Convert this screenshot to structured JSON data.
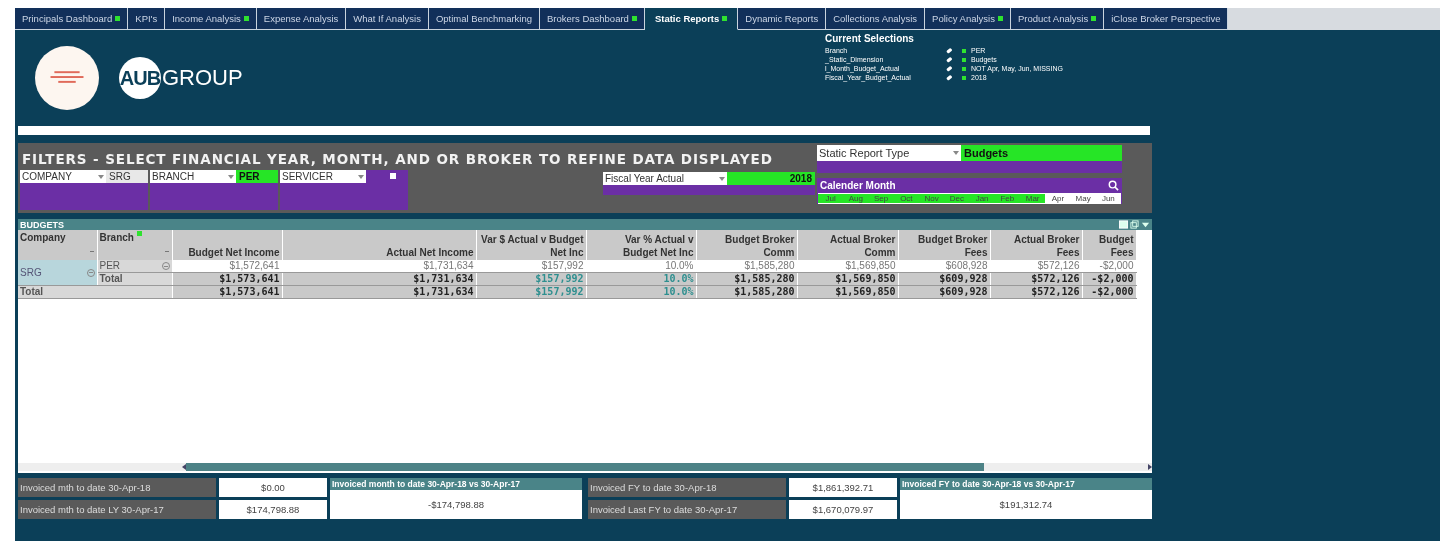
{
  "tabs": [
    {
      "label": "Principals Dashboard",
      "flagged": true,
      "selected": false
    },
    {
      "label": "KPI's",
      "flagged": false,
      "selected": false
    },
    {
      "label": "Income Analysis",
      "flagged": true,
      "selected": false
    },
    {
      "label": "Expense Analysis",
      "flagged": false,
      "selected": false
    },
    {
      "label": "What If Analysis",
      "flagged": false,
      "selected": false
    },
    {
      "label": "Optimal Benchmarking",
      "flagged": false,
      "selected": false
    },
    {
      "label": "Brokers Dashboard",
      "flagged": true,
      "selected": false
    },
    {
      "label": "Static Reports",
      "flagged": true,
      "selected": true
    },
    {
      "label": "Dynamic Reports",
      "flagged": false,
      "selected": false
    },
    {
      "label": "Collections Analysis",
      "flagged": false,
      "selected": false
    },
    {
      "label": "Policy Analysis",
      "flagged": true,
      "selected": false
    },
    {
      "label": "Product Analysis",
      "flagged": true,
      "selected": false
    },
    {
      "label": "iClose Broker Perspective",
      "flagged": false,
      "selected": false
    }
  ],
  "logo": {
    "mark": "AUB",
    "word": "GROUP"
  },
  "current_selections": {
    "title": "Current Selections",
    "items": [
      {
        "field": "Branch",
        "value": "PER"
      },
      {
        "field": "_Static_Dimension",
        "value": "Budgets"
      },
      {
        "field": "l_Month_Budget_Actual",
        "value": "NOT Apr, May, Jun, MISSING"
      },
      {
        "field": "Fiscal_Year_Budget_Actual",
        "value": "2018"
      }
    ]
  },
  "filters": {
    "title": "FILTERS - SELECT FINANCIAL YEAR, MONTH, AND OR BROKER TO REFINE DATA DISPLAYED",
    "dropdowns": [
      {
        "label": "COMPANY",
        "value": "SRG",
        "selected": false
      },
      {
        "label": "BRANCH",
        "value": "PER",
        "selected": true
      },
      {
        "label": "SERVICER"
      }
    ],
    "fiscal_year": {
      "label": "Fiscal Year Actual",
      "value": "2018",
      "selected": true
    },
    "report_type": {
      "label": "Static Report Type",
      "value": "Budgets",
      "selected": true
    },
    "calendar": {
      "title": "Calender Month",
      "months": [
        {
          "label": "Jul",
          "selected": true
        },
        {
          "label": "Aug",
          "selected": true
        },
        {
          "label": "Sep",
          "selected": true
        },
        {
          "label": "Oct",
          "selected": true
        },
        {
          "label": "Nov",
          "selected": true
        },
        {
          "label": "Dec",
          "selected": true
        },
        {
          "label": "Jan",
          "selected": true
        },
        {
          "label": "Feb",
          "selected": true
        },
        {
          "label": "Mar",
          "selected": true
        },
        {
          "label": "Apr",
          "selected": false
        },
        {
          "label": "May",
          "selected": false
        },
        {
          "label": "Jun",
          "selected": false
        }
      ]
    }
  },
  "table": {
    "title": "BUDGETS",
    "columns": [
      {
        "label": "Company",
        "kind": "dimension",
        "flagged": false
      },
      {
        "label": "Branch",
        "kind": "dimension",
        "flagged": true
      },
      {
        "label": "Budget Net Income",
        "kind": "money"
      },
      {
        "label": "Actual Net Income",
        "kind": "money"
      },
      {
        "label": "Var $ Actual v Budget Net Inc",
        "kind": "variance"
      },
      {
        "label": "Var % Actual v Budget Net Inc",
        "kind": "variance"
      },
      {
        "label": "Budget Broker Comm",
        "kind": "money"
      },
      {
        "label": "Actual Broker Comm",
        "kind": "money"
      },
      {
        "label": "Budget Broker Fees",
        "kind": "money"
      },
      {
        "label": "Actual Broker Fees",
        "kind": "money"
      },
      {
        "label": "Budget Fees",
        "kind": "money"
      }
    ],
    "rows": [
      {
        "kind": "detail",
        "company": "SRG",
        "selected": true,
        "branch": "PER",
        "values": [
          "$1,572,641",
          "$1,731,634",
          "$157,992",
          "10.0%",
          "$1,585,280",
          "$1,569,850",
          "$608,928",
          "$572,126",
          "-$2,000"
        ]
      },
      {
        "kind": "subtotal",
        "branch": "Total",
        "values": [
          "$1,573,641",
          "$1,731,634",
          "$157,992",
          "10.0%",
          "$1,585,280",
          "$1,569,850",
          "$609,928",
          "$572,126",
          "-$2,000"
        ]
      },
      {
        "kind": "total",
        "label": "Total",
        "values": [
          "$1,573,641",
          "$1,731,634",
          "$157,992",
          "10.0%",
          "$1,585,280",
          "$1,569,850",
          "$609,928",
          "$572,126",
          "-$2,000"
        ]
      }
    ]
  },
  "summary": [
    {
      "rows": [
        {
          "label": "Invoiced mth to date 30-Apr-18",
          "value": "$0.00"
        },
        {
          "label": "Invoiced mth to date LY 30-Apr-17",
          "value": "$174,798.88"
        }
      ],
      "comparison": {
        "title": "Invoiced month to date 30-Apr-18 vs 30-Apr-17",
        "value": "-$174,798.88"
      }
    },
    {
      "rows": [
        {
          "label": "Invoiced FY to date 30-Apr-18",
          "value": "$1,861,392.71"
        },
        {
          "label": "Invoiced Last FY to date 30-Apr-17",
          "value": "$1,670,079.97"
        }
      ],
      "comparison": {
        "title": "Invoiced FY to date 30-Apr-18 vs 30-Apr-17",
        "value": "$191,312.74"
      }
    }
  ]
}
